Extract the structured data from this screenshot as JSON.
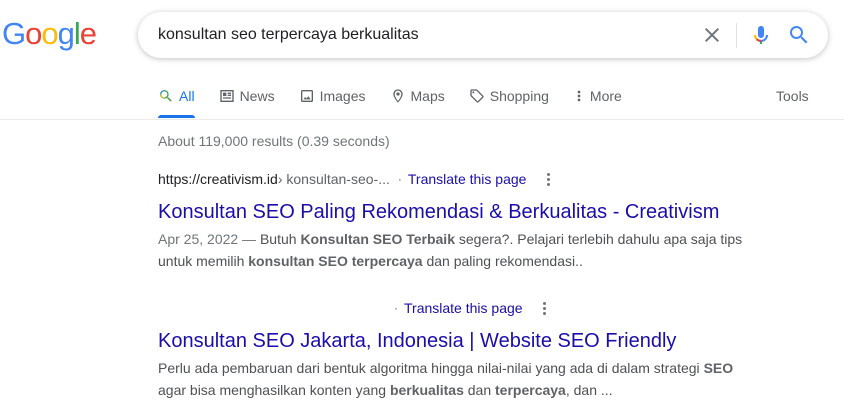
{
  "logo": {
    "letters": [
      {
        "ch": "G",
        "color": "#4285F4"
      },
      {
        "ch": "o",
        "color": "#EA4335"
      },
      {
        "ch": "o",
        "color": "#FBBC05"
      },
      {
        "ch": "g",
        "color": "#4285F4"
      },
      {
        "ch": "l",
        "color": "#34A853"
      },
      {
        "ch": "e",
        "color": "#EA4335"
      }
    ]
  },
  "search": {
    "query": "konsultan seo terpercaya berkualitas"
  },
  "icons": {
    "clear": "close-icon",
    "mic": "microphone-icon",
    "search": "search-icon"
  },
  "tabs": [
    {
      "label": "All",
      "icon": "search-icon",
      "active": true
    },
    {
      "label": "News",
      "icon": "news-icon",
      "active": false
    },
    {
      "label": "Images",
      "icon": "image-icon",
      "active": false
    },
    {
      "label": "Maps",
      "icon": "map-pin-icon",
      "active": false
    },
    {
      "label": "Shopping",
      "icon": "tag-icon",
      "active": false
    },
    {
      "label": "More",
      "icon": "more-vert-icon",
      "active": false
    }
  ],
  "tools_label": "Tools",
  "stats": "About 119,000 results (0.39 seconds)",
  "colors": {
    "accent": "#1a73e8",
    "link": "#1a0dab",
    "muted": "#70757a"
  },
  "results": [
    {
      "cite_url": "https://creativism.id",
      "cite_path": " › konsultan-seo-...",
      "translate": "Translate this page",
      "title": "Konsultan SEO Paling Rekomendasi & Berkualitas - Creativism",
      "date": "Apr 25, 2022 — ",
      "snippet_lines": [
        [
          {
            "t": "Butuh ",
            "b": false
          },
          {
            "t": "Konsultan SEO Terbaik",
            "b": true
          },
          {
            "t": " segera?. Pelajari terlebih dahulu apa saja tips",
            "b": false
          }
        ],
        [
          {
            "t": "untuk memilih ",
            "b": false
          },
          {
            "t": "konsultan SEO terpercaya",
            "b": true
          },
          {
            "t": " dan paling rekomendasi..",
            "b": false
          }
        ]
      ]
    },
    {
      "cite_url": "",
      "cite_path": "",
      "translate": "Translate this page",
      "title": "Konsultan SEO Jakarta, Indonesia | Website SEO Friendly",
      "date": "",
      "snippet_lines": [
        [
          {
            "t": "Perlu ada pembaruan dari bentuk algoritma hingga nilai-nilai yang ada di dalam strategi ",
            "b": false
          },
          {
            "t": "SEO",
            "b": true
          }
        ],
        [
          {
            "t": "agar bisa menghasilkan konten yang ",
            "b": false
          },
          {
            "t": "berkualitas",
            "b": true
          },
          {
            "t": " dan ",
            "b": false
          },
          {
            "t": "terpercaya",
            "b": true
          },
          {
            "t": ", dan ...",
            "b": false
          }
        ]
      ]
    }
  ]
}
